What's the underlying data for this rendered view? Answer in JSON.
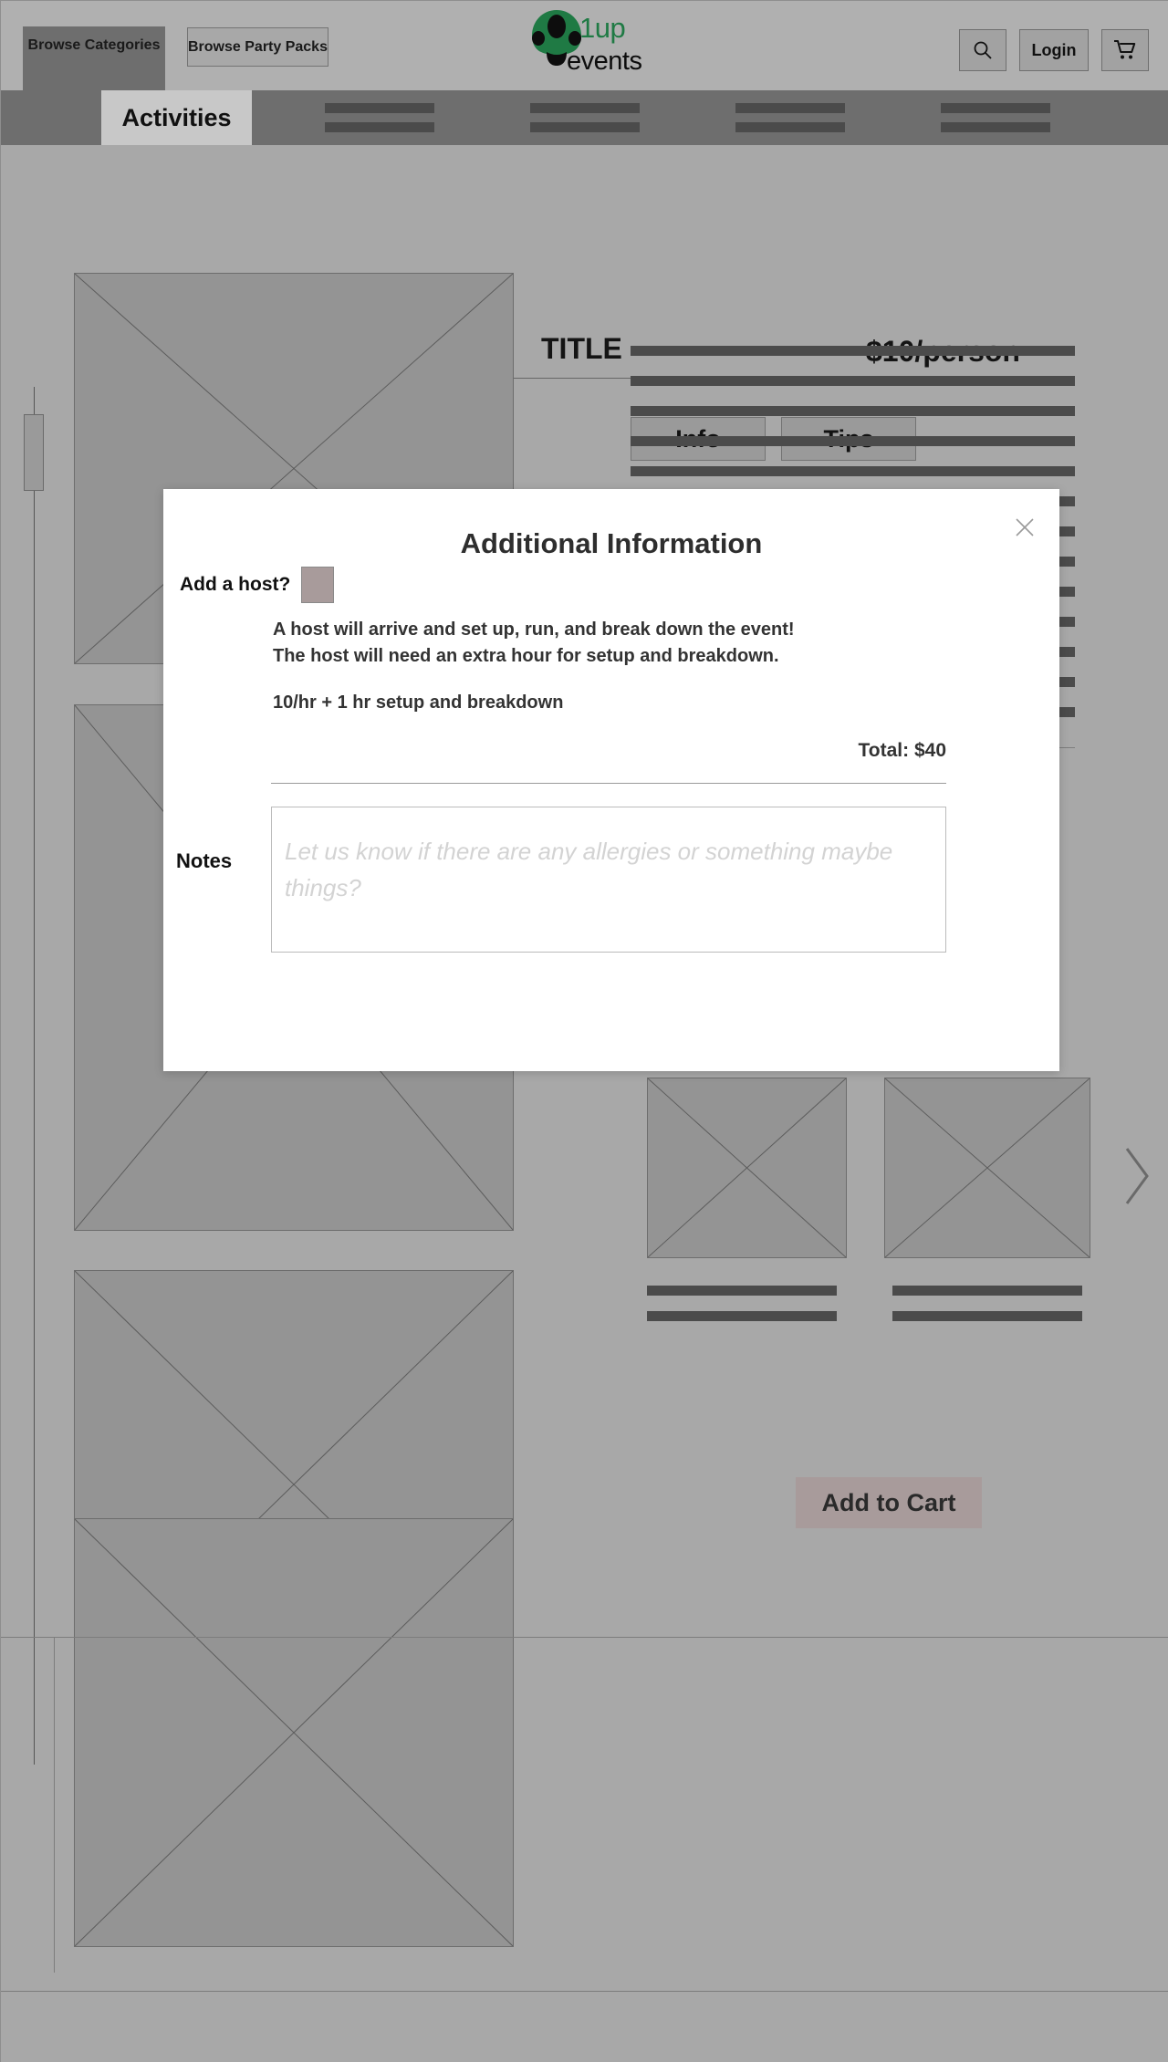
{
  "header": {
    "browse_categories": "Browse Categories",
    "browse_party_packs": "Browse Party Packs",
    "logo_primary": "1up",
    "logo_secondary": "events",
    "logo_color": "#1f7a44",
    "search_label": "search-icon",
    "login": "Login",
    "cart_label": "cart-icon"
  },
  "nav": {
    "active_tab": "Activities",
    "placeholder_items": 4
  },
  "product": {
    "title": "TITLE",
    "price": "$10/person",
    "tabs": [
      {
        "label": "Info"
      },
      {
        "label": "Tips"
      }
    ],
    "description_lines": 13
  },
  "modal": {
    "title": "Additional Information",
    "close_label": "close-icon",
    "host_question": "Add a host?",
    "host_checkbox_checked": false,
    "host_description_line1": "A host will arrive and set up, run, and break down the event!",
    "host_description_line2": "The host will need an extra hour for setup and breakdown.",
    "host_rate": "10/hr + 1 hr setup and breakdown",
    "total": "Total: $40",
    "notes_label": "Notes",
    "notes_value": "",
    "notes_placeholder": "Let us know if there are any allergies or something maybe things?",
    "add_to_cart": "Add to Cart"
  },
  "gallery": {
    "main_images": 4,
    "related_thumbnails": 2,
    "next_label": "chevron-right-icon"
  },
  "colors": {
    "page_bg": "#a8a8a8",
    "header_bg": "#b0b0b0",
    "nav_bg": "#6e6e6e",
    "placeholder": "#949494",
    "line": "#4b4b4b",
    "accent_green": "#1f7a44",
    "button_mauve": "#a89b9b"
  }
}
